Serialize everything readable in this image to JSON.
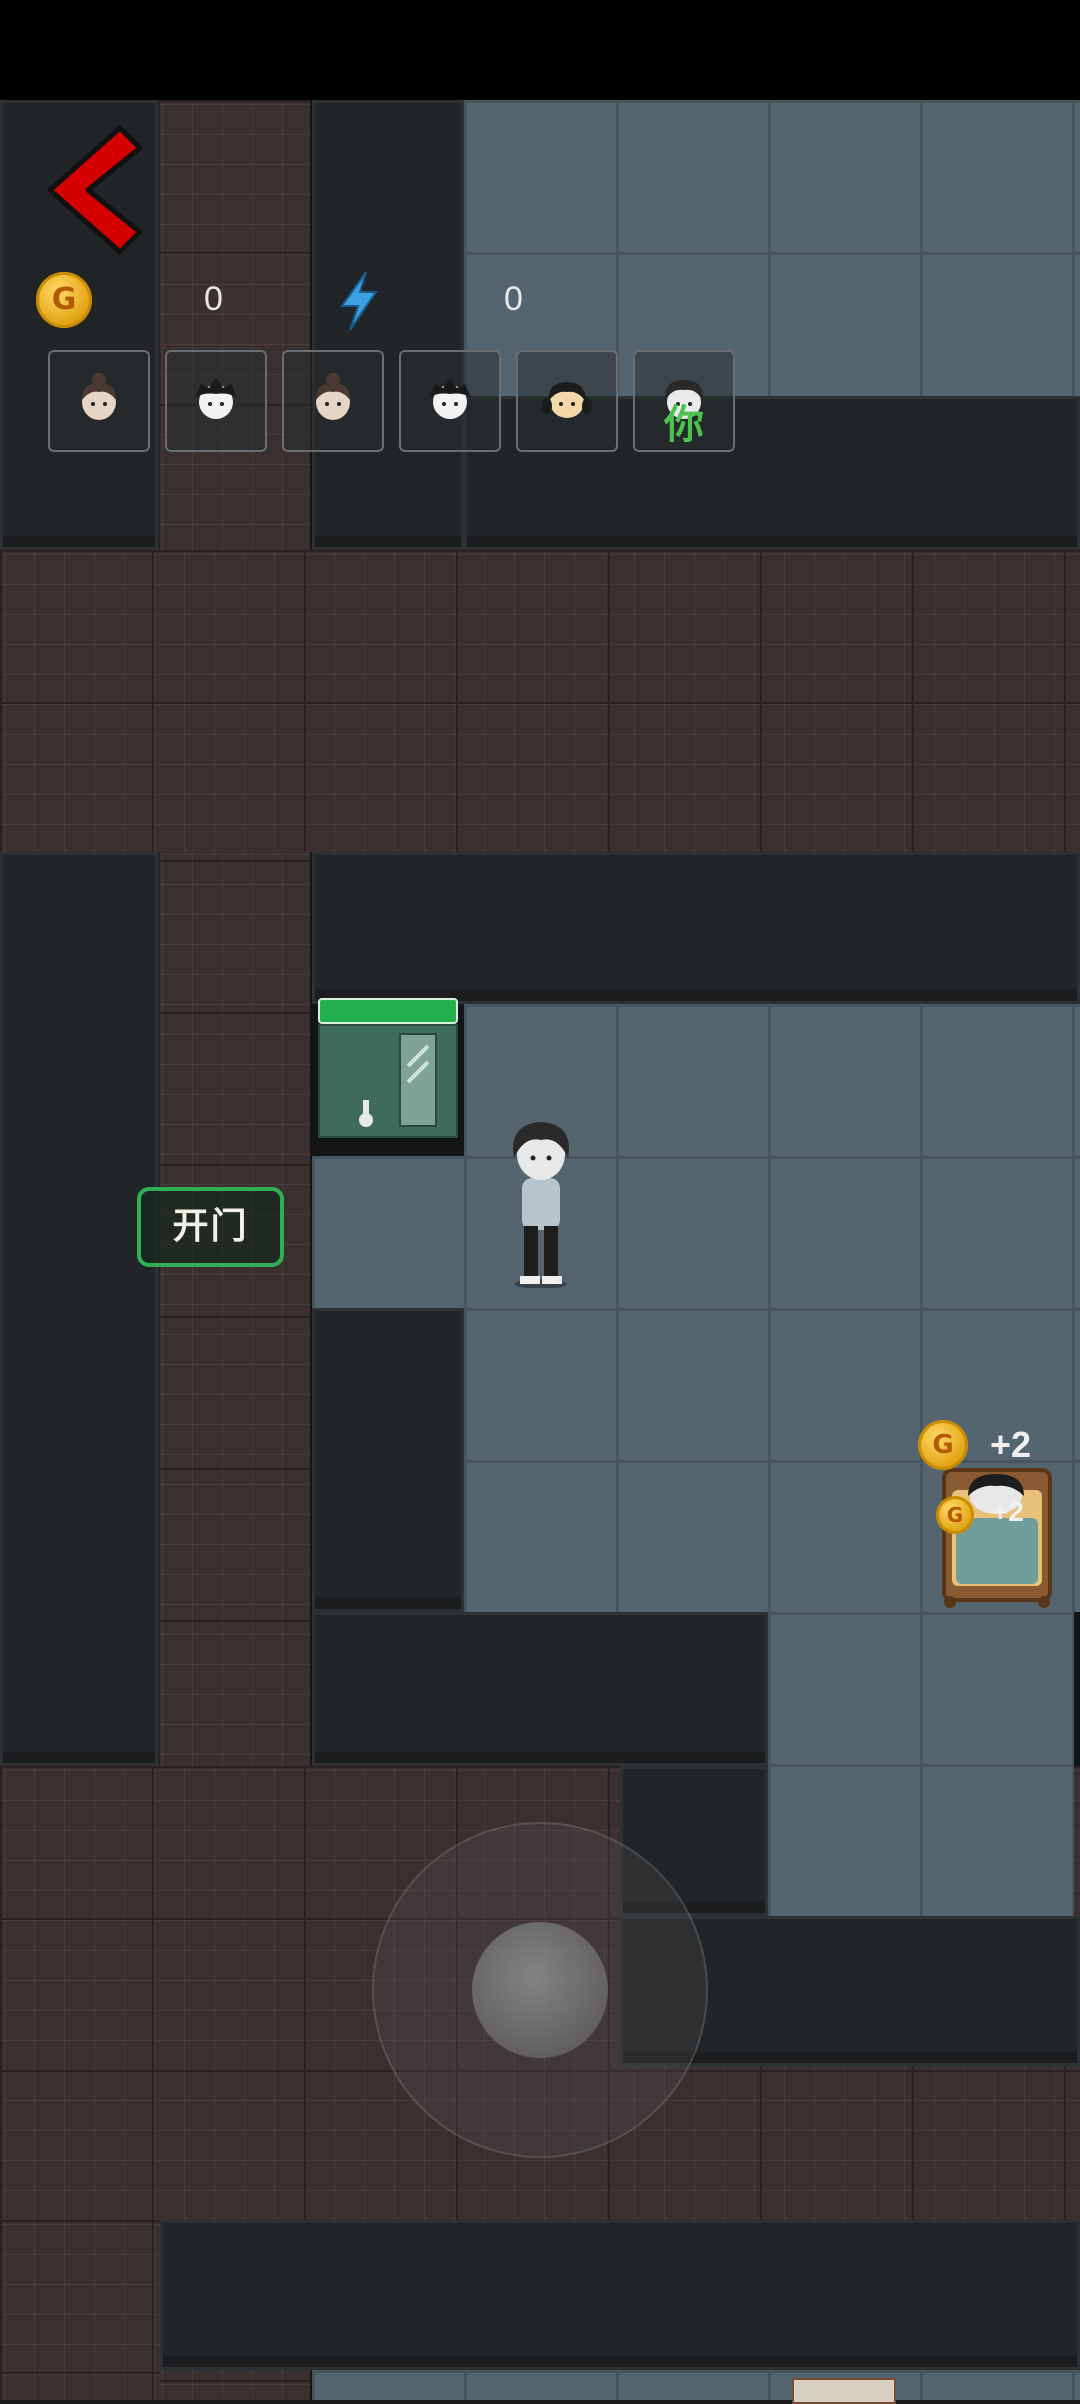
{
  "hud": {
    "back_icon": "chevron-left-icon",
    "coins": "0",
    "energy": "0",
    "coin_glyph": "G"
  },
  "players": [
    {
      "icon": "girl-bun-avatar-icon",
      "you": false
    },
    {
      "icon": "boy-messy-hair-avatar-icon",
      "you": false
    },
    {
      "icon": "girl-bun-avatar-icon",
      "you": false
    },
    {
      "icon": "boy-messy-hair-avatar-icon",
      "you": false
    },
    {
      "icon": "girl-pigtails-avatar-icon",
      "you": false
    },
    {
      "icon": "boy-dark-hair-avatar-icon",
      "you": true
    }
  ],
  "you_label": "你",
  "actions": {
    "open_door": "开门"
  },
  "rewards": {
    "large": "+2",
    "small": "+2"
  },
  "colors": {
    "accent_green": "#22b14c",
    "back_red": "#d40000",
    "coin_gold": "#f0b020",
    "energy_blue": "#3aa0e0"
  }
}
